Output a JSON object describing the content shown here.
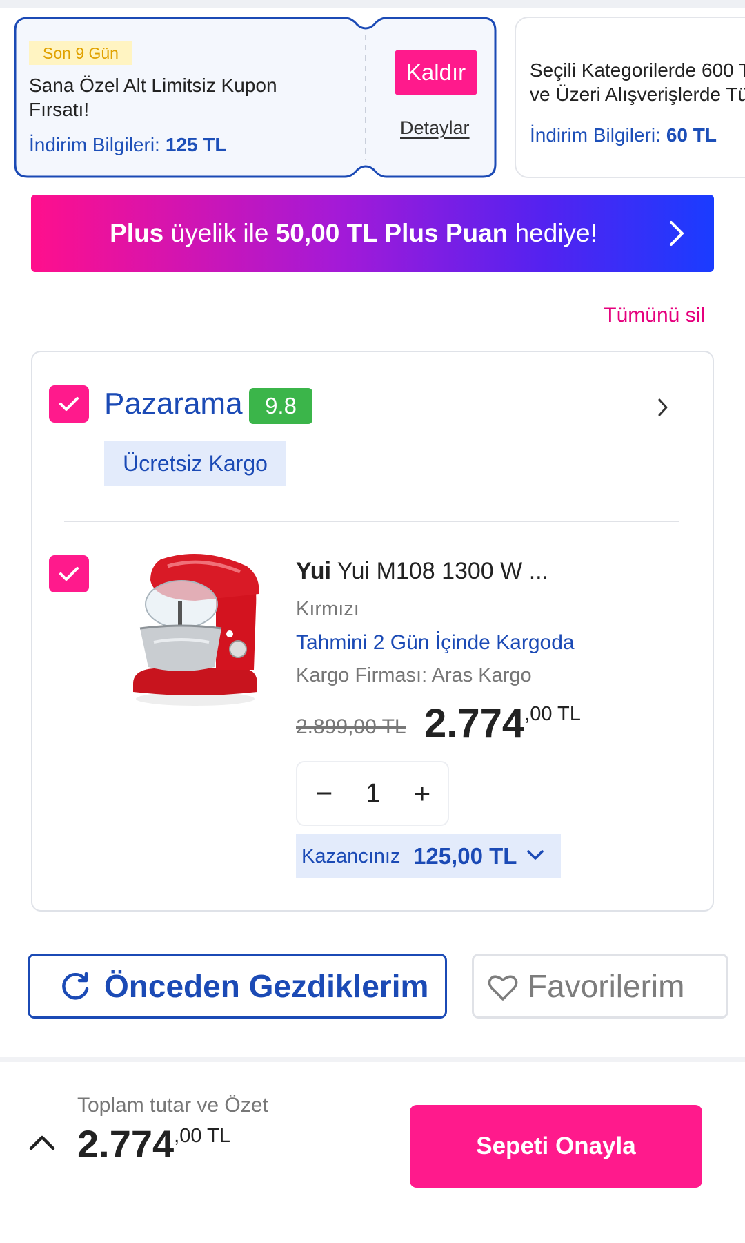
{
  "coupons": [
    {
      "badge": "Son 9 Gün",
      "title": "Sana Özel Alt Limitsiz Kupon Fırsatı!",
      "info_label": "İndirim Bilgileri:",
      "info_value": "125 TL",
      "remove_label": "Kaldır",
      "details_label": "Detaylar"
    },
    {
      "title_line1": "Seçili Kategorilerde 600 T",
      "title_line2": "ve Üzeri Alışverişlerde Tü",
      "info_label": "İndirim Bilgileri:",
      "info_value": "60 TL"
    }
  ],
  "plus_banner": {
    "part1": "Plus",
    "part2": " üyelik ile ",
    "part3": "50,00 TL Plus Puan",
    "part4": " hediye!"
  },
  "delete_all_label": "Tümünü sil",
  "seller": {
    "name": "Pazarama",
    "rating": "9.8",
    "shipping_badge": "Ücretsiz Kargo"
  },
  "product": {
    "brand": "Yui",
    "name": " Yui M108 1300 W ...",
    "color": "Kırmızı",
    "shipping_estimate": "Tahmini 2 Gün İçinde Kargoda",
    "carrier": "Kargo Firması: Aras Kargo",
    "old_price": "2.899,00 TL",
    "price_int": "2.774",
    "price_dec": ",00",
    "currency": " TL",
    "quantity": "1",
    "minus": "−",
    "plus": "+",
    "savings_label": "Kazancınız",
    "savings_value": "125,00 TL"
  },
  "buttons": {
    "previously_viewed": "Önceden Gezdiklerim",
    "favorites": "Favorilerim"
  },
  "footer": {
    "label": "Toplam tutar ve Özet",
    "total_int": "2.774",
    "total_dec": ",00",
    "currency": " TL",
    "confirm": "Sepeti Onayla"
  },
  "colors": {
    "accent_pink": "#ff1a8c",
    "brand_blue": "#1b4ab5",
    "rating_green": "#3bb54a"
  }
}
